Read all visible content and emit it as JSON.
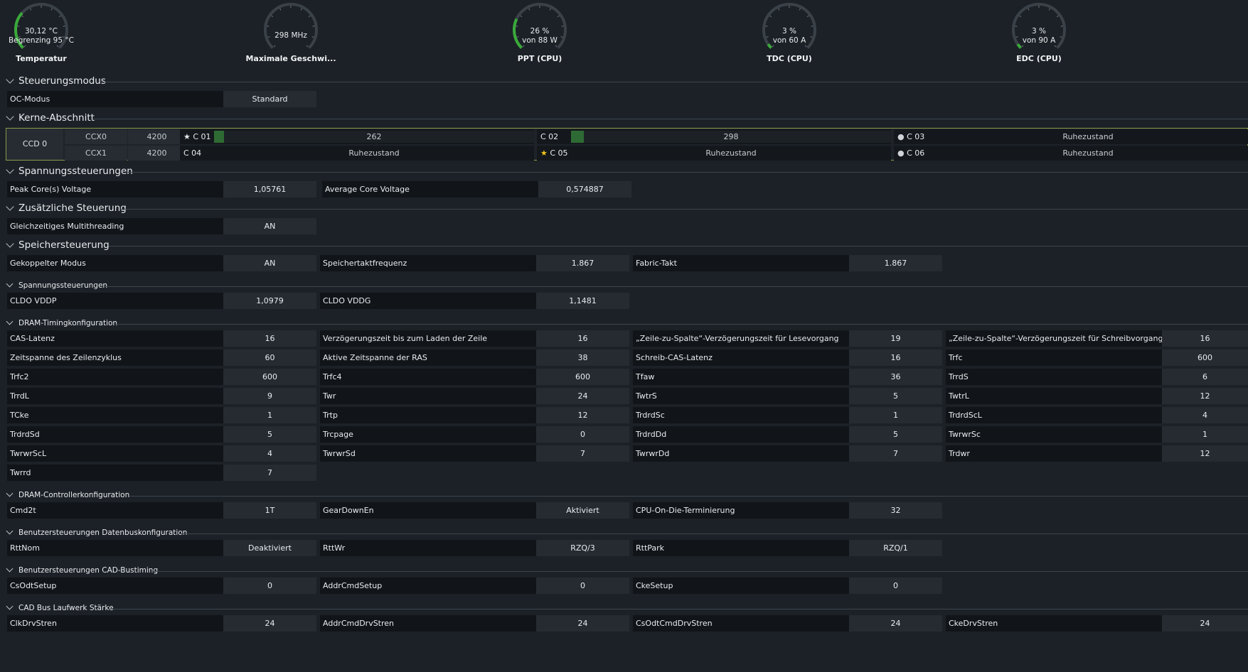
{
  "gauges": [
    {
      "line1": "30,12 °C",
      "line2": "Begrenzing  95 °C",
      "label": "Temperatur",
      "fill": 0.32,
      "color": "#3aaa3a"
    },
    {
      "line1": "298  MHz",
      "line2": "",
      "label": "Maximale Geschwi...",
      "fill": 0.0,
      "color": "#3aaa3a"
    },
    {
      "line1": "26 %",
      "line2": "von  88 W",
      "label": "PPT (CPU)",
      "fill": 0.26,
      "color": "#3aaa3a"
    },
    {
      "line1": "3 %",
      "line2": "von  60 A",
      "label": "TDC (CPU)",
      "fill": 0.03,
      "color": "#3aaa3a"
    },
    {
      "line1": "3 %",
      "line2": "von  90 A",
      "label": "EDC (CPU)",
      "fill": 0.03,
      "color": "#3aaa3a"
    }
  ],
  "sections": {
    "steuerungsmodus": "Steuerungsmodus",
    "kerne": "Kerne-Abschnitt",
    "spannung": "Spannungssteuerungen",
    "zusatz": "Zusätzliche Steuerung",
    "speicher": "Speichersteuerung",
    "spannung2": "Spannungssteuerungen",
    "dram_timing": "DRAM-Timingkonfiguration",
    "dram_ctrl": "DRAM-Controllerkonfiguration",
    "datenbus": "Benutzersteuerungen Datenbuskonfiguration",
    "cad": "Benutzersteuerungen CAD-Bustiming",
    "cad_drive": "CAD Bus Laufwerk Stärke"
  },
  "oc_mode": {
    "label": "OC-Modus",
    "value": "Standard"
  },
  "ccd": {
    "label": "CCD 0",
    "ccx": [
      {
        "name": "CCX0",
        "freq": "4200"
      },
      {
        "name": "CCX1",
        "freq": "4200"
      }
    ],
    "cores": [
      {
        "name": "C 01",
        "value": "262",
        "marker": "★",
        "marker_color": "#e6e6e6",
        "active": true,
        "fill": 0.03
      },
      {
        "name": "C 02",
        "value": "298",
        "marker": "",
        "marker_color": "#e6e6e6",
        "active": true,
        "fill": 0.04
      },
      {
        "name": "C 03",
        "value": "Ruhezustand",
        "marker": "●",
        "marker_color": "#d0d4d8",
        "active": false,
        "fill": 0
      },
      {
        "name": "C 04",
        "value": "Ruhezustand",
        "marker": "",
        "marker_color": "#e6e6e6",
        "active": false,
        "fill": 0
      },
      {
        "name": "C 05",
        "value": "Ruhezustand",
        "marker": "★",
        "marker_color": "#f0c419",
        "active": false,
        "fill": 0
      },
      {
        "name": "C 06",
        "value": "Ruhezustand",
        "marker": "●",
        "marker_color": "#d0d4d8",
        "active": false,
        "fill": 0
      }
    ]
  },
  "voltage": [
    {
      "label": "Peak Core(s) Voltage",
      "value": "1,05761"
    },
    {
      "label": "Average Core Voltage",
      "value": "0,574887"
    }
  ],
  "extra": [
    {
      "label": "Gleichzeitiges Multithreading",
      "value": "AN"
    }
  ],
  "memory": [
    {
      "label": "Gekoppelter Modus",
      "value": "AN"
    },
    {
      "label": "Speichertaktfrequenz",
      "value": "1.867"
    },
    {
      "label": "Fabric-Takt",
      "value": "1.867"
    }
  ],
  "voltage2": [
    {
      "label": "CLDO VDDP",
      "value": "1,0979"
    },
    {
      "label": "CLDO VDDG",
      "value": "1,1481"
    }
  ],
  "dram_timing": [
    [
      {
        "label": "CAS-Latenz",
        "value": "16"
      },
      {
        "label": "Verzögerungszeit bis zum Laden der Zeile",
        "value": "16"
      },
      {
        "label": "„Zeile-zu-Spalte“-Verzögerungszeit für Lesevorgang",
        "value": "19"
      },
      {
        "label": "„Zeile-zu-Spalte“-Verzögerungszeit für Schreibvorgang",
        "value": "16"
      }
    ],
    [
      {
        "label": "Zeitspanne des Zeilenzyklus",
        "value": "60"
      },
      {
        "label": "Aktive Zeitspanne der RAS",
        "value": "38"
      },
      {
        "label": "Schreib-CAS-Latenz",
        "value": "16"
      },
      {
        "label": "Trfc",
        "value": "600"
      }
    ],
    [
      {
        "label": "Trfc2",
        "value": "600"
      },
      {
        "label": "Trfc4",
        "value": "600"
      },
      {
        "label": "Tfaw",
        "value": "36"
      },
      {
        "label": "TrrdS",
        "value": "6"
      }
    ],
    [
      {
        "label": "TrrdL",
        "value": "9"
      },
      {
        "label": "Twr",
        "value": "24"
      },
      {
        "label": "TwtrS",
        "value": "5"
      },
      {
        "label": "TwtrL",
        "value": "12"
      }
    ],
    [
      {
        "label": "TCke",
        "value": "1"
      },
      {
        "label": "Trtp",
        "value": "12"
      },
      {
        "label": "TrdrdSc",
        "value": "1"
      },
      {
        "label": "TrdrdScL",
        "value": "4"
      }
    ],
    [
      {
        "label": "TrdrdSd",
        "value": "5"
      },
      {
        "label": "Trcpage",
        "value": "0"
      },
      {
        "label": "TrdrdDd",
        "value": "5"
      },
      {
        "label": "TwrwrSc",
        "value": "1"
      }
    ],
    [
      {
        "label": "TwrwrScL",
        "value": "4"
      },
      {
        "label": "TwrwrSd",
        "value": "7"
      },
      {
        "label": "TwrwrDd",
        "value": "7"
      },
      {
        "label": "Trdwr",
        "value": "12"
      }
    ],
    [
      {
        "label": "Twrrd",
        "value": "7"
      }
    ]
  ],
  "dram_ctrl": [
    {
      "label": "Cmd2t",
      "value": "1T"
    },
    {
      "label": "GearDownEn",
      "value": "Aktiviert"
    },
    {
      "label": "CPU-On-Die-Terminierung",
      "value": "32"
    }
  ],
  "datenbus": [
    {
      "label": "RttNom",
      "value": "Deaktiviert"
    },
    {
      "label": "RttWr",
      "value": "RZQ/3"
    },
    {
      "label": "RttPark",
      "value": "RZQ/1"
    }
  ],
  "cad": [
    {
      "label": "CsOdtSetup",
      "value": "0"
    },
    {
      "label": "AddrCmdSetup",
      "value": "0"
    },
    {
      "label": "CkeSetup",
      "value": "0"
    }
  ],
  "cad_drive": [
    {
      "label": "ClkDrvStren",
      "value": "24"
    },
    {
      "label": "AddrCmdDrvStren",
      "value": "24"
    },
    {
      "label": "CsOdtCmdDrvStren",
      "value": "24"
    },
    {
      "label": "CkeDrvStren",
      "value": "24"
    }
  ]
}
